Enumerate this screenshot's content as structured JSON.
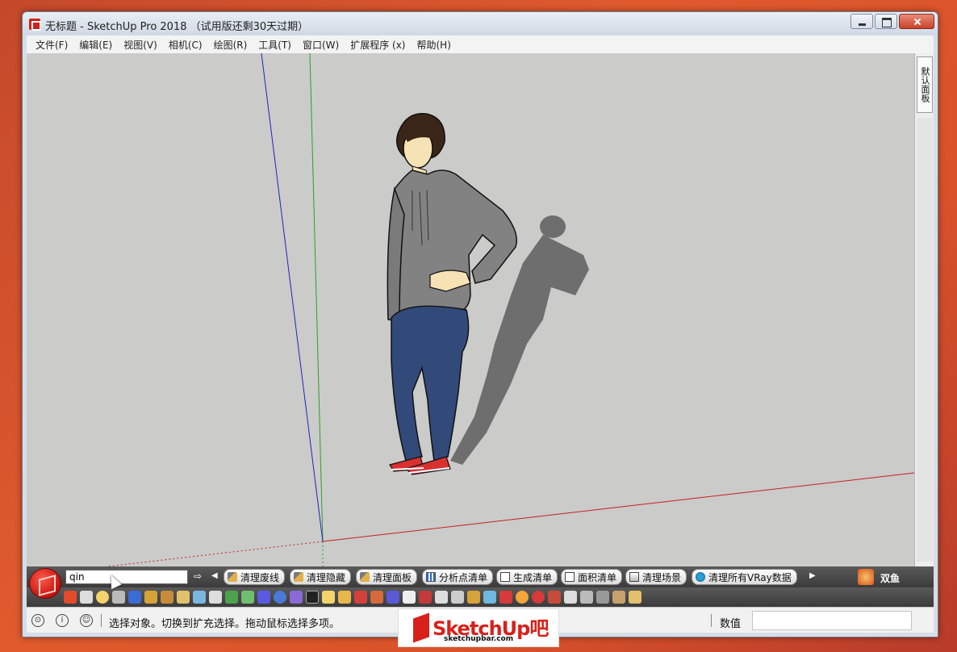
{
  "window": {
    "title": "无标题 - SketchUp Pro 2018 （试用版还剩30天过期）"
  },
  "menu": {
    "items": [
      {
        "label": "文件(F)"
      },
      {
        "label": "编辑(E)"
      },
      {
        "label": "视图(V)"
      },
      {
        "label": "相机(C)"
      },
      {
        "label": "绘图(R)"
      },
      {
        "label": "工具(T)"
      },
      {
        "label": "窗口(W)"
      },
      {
        "label": "扩展程序 (x)"
      },
      {
        "label": "帮助(H)"
      }
    ]
  },
  "tray": {
    "default_tray_label": "默认面板"
  },
  "toolbar": {
    "search_value": "qin",
    "buttons": [
      {
        "label": "清理废线",
        "icon": "broom-icon"
      },
      {
        "label": "清理隐藏",
        "icon": "broom-icon"
      },
      {
        "label": "清理面板",
        "icon": "broom-icon"
      },
      {
        "label": "分析点清单",
        "icon": "chart-icon"
      },
      {
        "label": "生成清单",
        "icon": "list-icon"
      },
      {
        "label": "面积清单",
        "icon": "list-icon"
      },
      {
        "label": "清理场景",
        "icon": "scene-icon"
      },
      {
        "label": "清理所有VRay数据",
        "icon": "vray-icon"
      }
    ],
    "plugin_label": "双鱼"
  },
  "statusbar": {
    "message": "选择对象。切换到扩充选择。拖动鼠标选择多项。",
    "measurement_label": "数值",
    "measurement_value": ""
  },
  "watermark": {
    "main": "SketchUp吧",
    "sub": "sketchupbar.com"
  },
  "colors": {
    "viewport_bg": "#cbcbc9",
    "axis_red": "#c22222",
    "axis_green": "#2aa02a",
    "axis_blue": "#2222c2",
    "toolbar_bg": "#4a4a4a",
    "brand_red": "#d8211b"
  }
}
